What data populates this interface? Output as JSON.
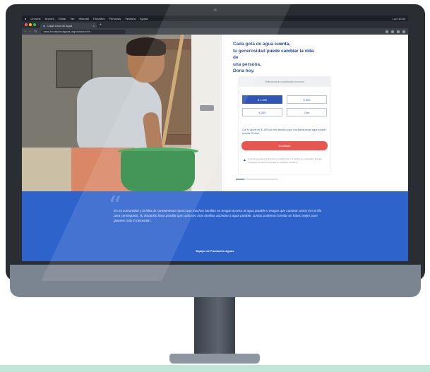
{
  "browser": {
    "menubar": [
      "Chrome",
      "Archivo",
      "Editar",
      "Ver",
      "Historial",
      "Favoritos",
      "Personas",
      "Ventana",
      "Ayuda"
    ],
    "menubar_right": "Lun 10:30",
    "tab_title": "Cada Gota de Agua",
    "url": "www.fundacionaguas.org/donaciones"
  },
  "donation": {
    "headline": "Cada gota de agua cuenta,\ntu generosidad puede cambiar la vida de\nuna persona.\nDona hoy.",
    "card_header": "Selecciona tu contribución mensual",
    "amounts": [
      "$ 1.000",
      "$ 500",
      "$ 300",
      "Otro"
    ],
    "selected_index": 0,
    "note": "Con tu aporte de $1.000 por mes ayudas a que una familia tenga agua potable durante 30 días.",
    "cta_label": "Continuar",
    "legal": "Al donar aceptas los términos y condiciones y la política de privacidad. Puedes cancelar tu donación mensual en cualquier momento."
  },
  "quote": {
    "text": "En mi comunidad y la falta de saneamiento hacen que muchas familias no tengan acceso al agua potable o tengan que caminar varios km al día para conseguirla. Tu donación hace posible que cada vez más familias accedan a agua potable. Juntos podemos brindar un futuro mejor para quienes más lo necesitan.",
    "author": "Equipo de Fundación Aguas"
  },
  "colors": {
    "brand_blue": "#2f63cc",
    "headline_blue": "#1b3f86",
    "cta_red": "#e8574f"
  }
}
